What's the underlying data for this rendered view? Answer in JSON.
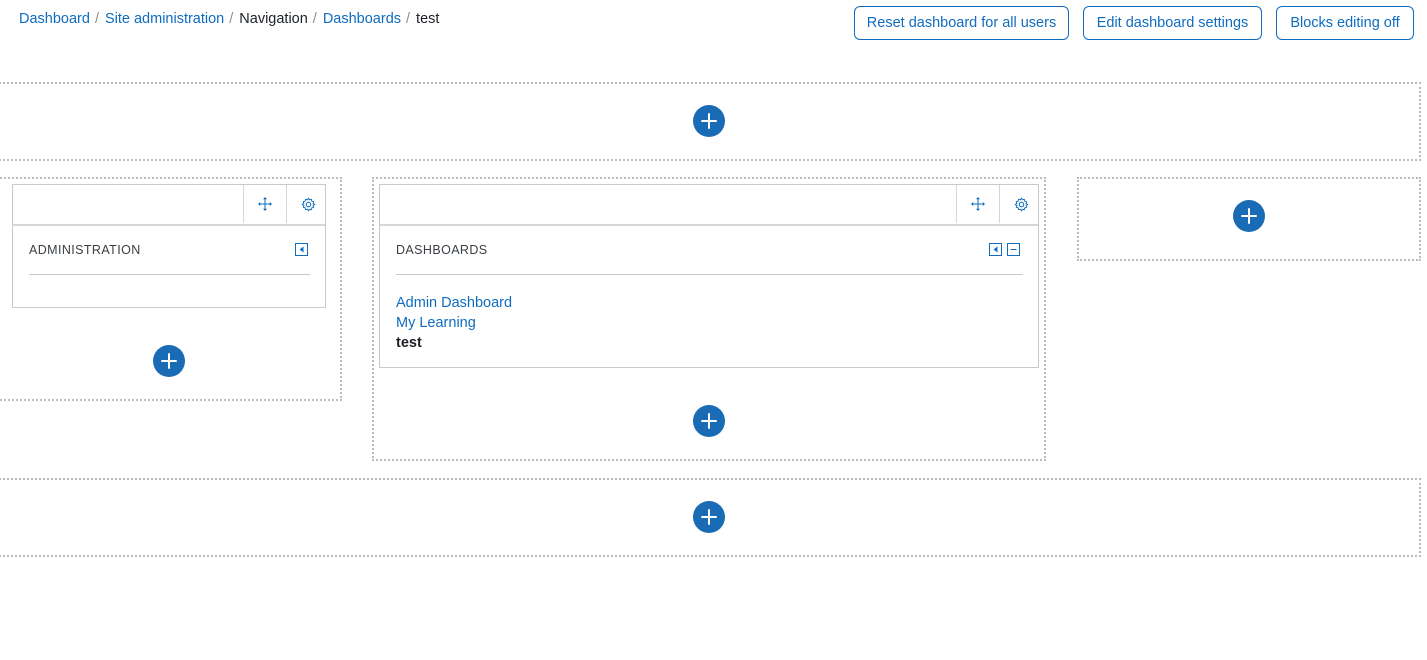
{
  "breadcrumb": {
    "items": [
      {
        "label": "Dashboard",
        "link": true
      },
      {
        "label": "Site administration",
        "link": true
      },
      {
        "label": "Navigation",
        "link": false
      },
      {
        "label": "Dashboards",
        "link": true
      },
      {
        "label": "test",
        "link": false
      }
    ],
    "separator": "/"
  },
  "toolbar": {
    "reset_label": "Reset dashboard for all users",
    "settings_label": "Edit dashboard settings",
    "editing_label": "Blocks editing off"
  },
  "blocks": {
    "administration": {
      "title": "ADMINISTRATION"
    },
    "dashboards": {
      "title": "DASHBOARDS",
      "items": [
        {
          "label": "Admin Dashboard",
          "current": false
        },
        {
          "label": "My Learning",
          "current": false
        },
        {
          "label": "test",
          "current": true
        }
      ]
    }
  },
  "colors": {
    "accent": "#0f6cbf",
    "add_button": "#1a6bb5",
    "region_border": "#b9bcc0"
  },
  "icons": {
    "add": "plus-circle-icon",
    "move": "move-arrows-icon",
    "configure": "gear-icon",
    "dock": "dock-left-icon",
    "collapse": "minus-icon"
  }
}
